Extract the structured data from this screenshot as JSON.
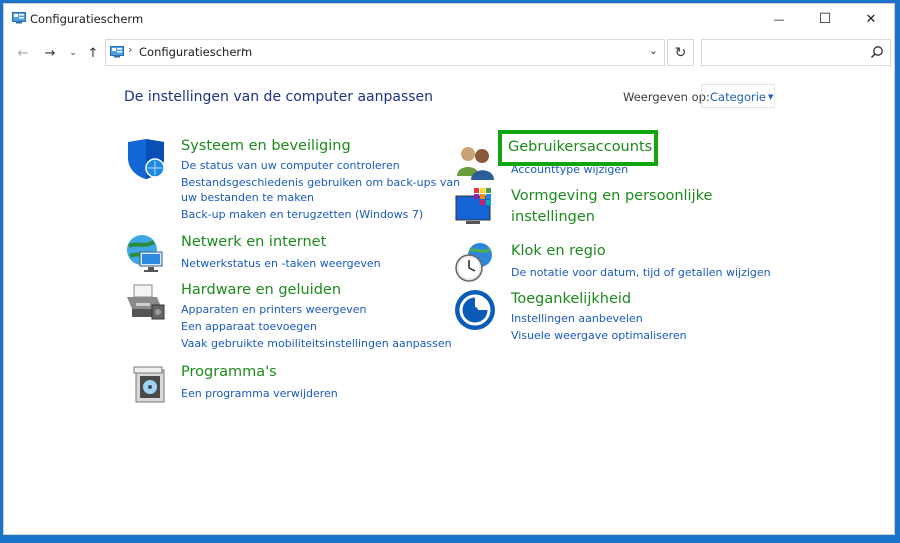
{
  "window": {
    "title": "Configuratiescherm",
    "controls": {
      "minimize": "—",
      "maximize": "☐",
      "close": "✕"
    }
  },
  "nav": {
    "back": "←",
    "forward": "→",
    "recent": "⌄",
    "up": "↑",
    "address_separator": "›",
    "address": "Configuratiescherm",
    "dropdown": "⌄",
    "refresh": "↻",
    "search_placeholder": ""
  },
  "content": {
    "heading": "De instellingen van de computer aanpassen",
    "view_by_label": "Weergeven op:",
    "view_by_value": "Categorie",
    "view_by_caret": "▼"
  },
  "categories": [
    {
      "title": "Systeem en beveiliging",
      "icon": "shield-icon",
      "links": [
        "De status van uw computer controleren",
        "Bestandsgeschiedenis gebruiken om back-ups van",
        "uw bestanden te maken",
        "Back-up maken en terugzetten (Windows 7)"
      ]
    },
    {
      "title": "Netwerk en internet",
      "icon": "network-globe-icon",
      "links": [
        "Netwerkstatus en -taken weergeven"
      ]
    },
    {
      "title": "Hardware en geluiden",
      "icon": "printer-icon",
      "links": [
        "Apparaten en printers weergeven",
        "Een apparaat toevoegen",
        "Vaak gebruikte mobiliteitsinstellingen aanpassen"
      ]
    },
    {
      "title": "Programma's",
      "icon": "programs-icon",
      "links": [
        "Een programma verwijderen"
      ]
    },
    {
      "title": "Gebruikersaccounts",
      "icon": "users-icon",
      "links": [
        "Accounttype wijzigen"
      ]
    },
    {
      "title": "Vormgeving en persoonlijke",
      "title_line2": "instellingen",
      "icon": "appearance-monitor-icon",
      "links": []
    },
    {
      "title": "Klok en regio",
      "icon": "clock-globe-icon",
      "links": [
        "De notatie voor datum, tijd of getallen wijzigen"
      ]
    },
    {
      "title": "Toegankelijkheid",
      "icon": "accessibility-icon",
      "links": [
        "Instellingen aanbevelen",
        "Visuele weergave optimaliseren"
      ]
    }
  ],
  "colors": {
    "category_title": "#1c8a1c",
    "link": "#1a5bbd",
    "heading": "#1e3287",
    "highlight_border": "#11a511"
  }
}
